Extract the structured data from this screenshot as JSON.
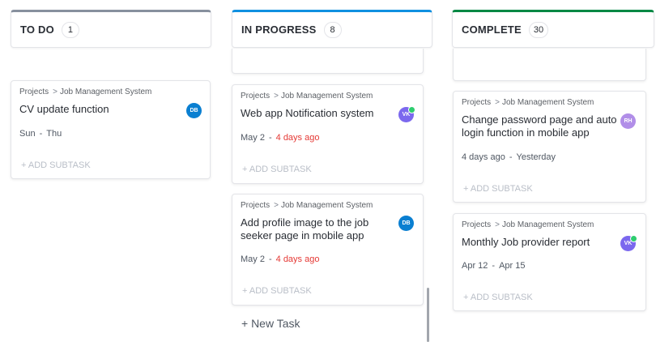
{
  "columns": [
    {
      "title": "TO DO",
      "count": "1",
      "color": "#87909e"
    },
    {
      "title": "IN PROGRESS",
      "count": "8",
      "color": "#1090e0"
    },
    {
      "title": "COMPLETE",
      "count": "30",
      "color": "#008844"
    }
  ],
  "breadcrumb": {
    "root": "Projects",
    "project": "Job Management System"
  },
  "add_subtask_label": "+ ADD SUBTASK",
  "new_task_label": "+ New Task",
  "tasks": [
    {
      "title": "CV update function",
      "start": "Sun",
      "end": "Thu",
      "avatar": "DB"
    },
    {
      "title": "Web app Notification system",
      "start": "May 2",
      "end": "4 days ago",
      "avatar": "VK"
    },
    {
      "title": "Add profile image to the job seeker page in mobile app",
      "start": "May 2",
      "end": "4 days ago",
      "avatar": "DB"
    },
    {
      "title": "Change password page and auto login function in mobile app",
      "start": "4 days ago",
      "end": "Yesterday",
      "avatar": "RH"
    },
    {
      "title": "Monthly Job provider report",
      "start": "Apr 12",
      "end": "Apr 15",
      "avatar": "VK"
    }
  ]
}
